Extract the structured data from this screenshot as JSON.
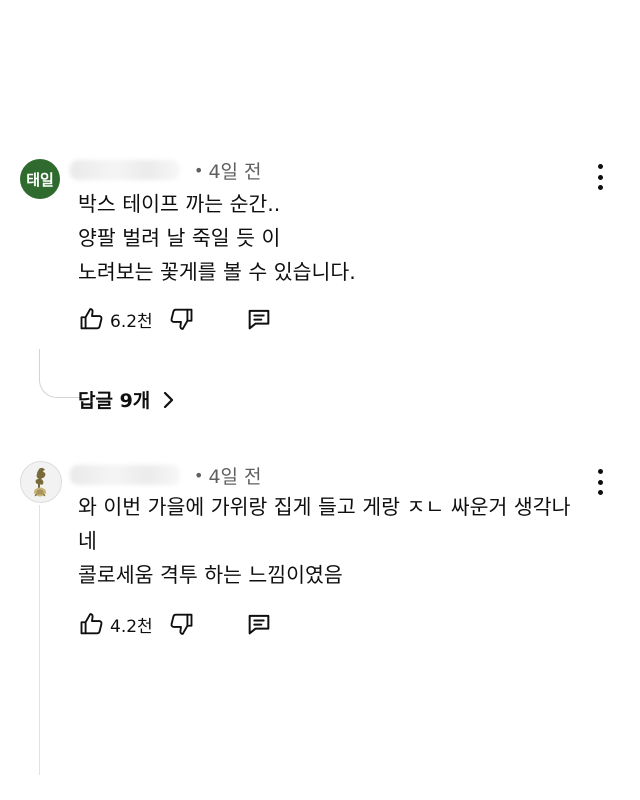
{
  "comments": [
    {
      "avatar_text": "태일",
      "avatar_color": "#2f6b2f",
      "separator": "•",
      "time": "4일 전",
      "lines": [
        "박스 테이프 까는 순간..",
        "양팔 벌려 날 죽일 듯 이",
        "노려보는 꽃게를 볼 수 있습니다."
      ],
      "likes": "6.2천",
      "replies_label": "답글 9개",
      "icons": {
        "menu": "more-vert-icon",
        "like": "thumbs-up-icon",
        "dislike": "thumbs-down-icon",
        "reply": "comment-icon",
        "replies": "chevron-right-icon"
      }
    },
    {
      "avatar_icon": "cockerel-emblem-icon",
      "separator": "•",
      "time": "4일 전",
      "lines": [
        "와 이번 가을에 가위랑 집게 들고 게랑 ㅈㄴ 싸운거 생각나",
        "네",
        "콜로세움 격투 하는 느낌이였음"
      ],
      "likes": "4.2천",
      "icons": {
        "menu": "more-vert-icon",
        "like": "thumbs-up-icon",
        "dislike": "thumbs-down-icon",
        "reply": "comment-icon"
      }
    }
  ]
}
